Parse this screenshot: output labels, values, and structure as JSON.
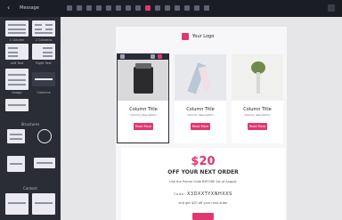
{
  "topbar": {
    "title": "Message",
    "icon_names": [
      "undo-icon",
      "redo-icon",
      "desktop-icon",
      "mobile-icon",
      "preview-icon",
      "code-icon",
      "settings-icon",
      "text-icon",
      "image-icon",
      "button-icon",
      "divider-icon",
      "spacer-icon",
      "social-icon",
      "video-icon",
      "save-icon"
    ],
    "active_icon_index": 8
  },
  "sidebar": {
    "row_labels": [
      "1 Column",
      "2 Columns",
      "Left Text",
      "Right Text",
      "Image",
      "Columns"
    ],
    "section_1": "Structures",
    "section_2": "Content"
  },
  "email": {
    "logo_text": "Your Logo",
    "columns": [
      {
        "title": "Column Title",
        "desc": "Column description",
        "button": "Read More"
      },
      {
        "title": "Column Title",
        "desc": "Column description",
        "button": "Read More"
      },
      {
        "title": "Column Title",
        "desc": "Column description",
        "button": "Read More"
      }
    ],
    "promo": {
      "amount": "$20",
      "headline": "OFF YOUR NEXT ORDER",
      "line1": "Use the Promo Code BEFORE 1st of August",
      "code_label": "Code:",
      "code": "X3DXXTYXNHXXS",
      "line3": "and get $20 off your next order"
    }
  },
  "colors": {
    "accent": "#e0376f",
    "topbar": "#1b1d25",
    "sidebar": "#2a2c36",
    "canvas": "#e6e6e9"
  }
}
